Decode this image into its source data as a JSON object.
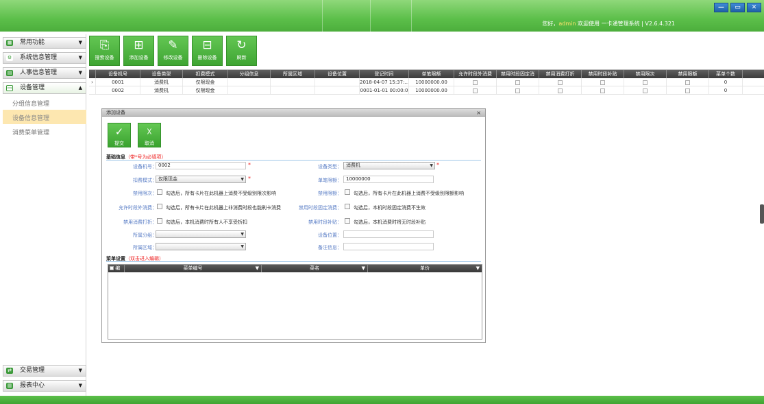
{
  "header": {
    "greeting": "您好，",
    "user": "admin",
    "welcome": "欢迎使用 一卡通管理系统  |  V2.6.4.321",
    "window_buttons": [
      "—",
      "▭",
      "✕"
    ]
  },
  "sidebar": {
    "sections": [
      {
        "label": "常用功能",
        "icon": "grid-icon"
      },
      {
        "label": "系统信息管理",
        "icon": "gear-icon"
      },
      {
        "label": "人事信息管理",
        "icon": "id-card-icon"
      },
      {
        "label": "设备管理",
        "icon": "device-icon"
      }
    ],
    "subitems": [
      "分组信息管理",
      "设备信息管理",
      "消费菜单管理"
    ],
    "selected_subitem": "设备信息管理",
    "bottom_sections": [
      {
        "label": "交易管理",
        "icon": "exchange-icon"
      },
      {
        "label": "报表中心",
        "icon": "chart-icon"
      }
    ]
  },
  "toolbar": {
    "buttons": [
      "搜索设备",
      "添加设备",
      "修改设备",
      "删除设备",
      "刷新"
    ]
  },
  "grid": {
    "headers": [
      "设备机号",
      "设备类型",
      "扣费模式",
      "分组信息",
      "所属区域",
      "设备位置",
      "登记时间",
      "单笔限额",
      "允许时段外消费",
      "禁用时段固定消",
      "禁用消费打折",
      "禁用时段补贴",
      "禁用限次",
      "禁用限额",
      "菜单个数"
    ],
    "rows": [
      [
        "0001",
        "消费机",
        "仅限现金",
        "",
        "",
        "",
        "2018-04-07 15:37:…",
        "10000000.00",
        "",
        "",
        "",
        "",
        "",
        "",
        "0"
      ],
      [
        "0002",
        "消费机",
        "仅限现金",
        "",
        "",
        "",
        "0001-01-01 00:00:0",
        "10000000.00",
        "",
        "",
        "",
        "",
        "",
        "",
        "0"
      ]
    ]
  },
  "dialog": {
    "title": "添加设备",
    "close": "×",
    "submit_label": "提交",
    "cancel_label": "取消",
    "basic_section": "基础信息",
    "basic_hint": "（带*号为必填项）",
    "fields": {
      "device_no_label": "设备机号：",
      "device_no_value": "0002",
      "device_type_label": "设备类型：",
      "device_type_value": "消费机",
      "mode_label": "扣费模式：",
      "mode_value": "仅限现金",
      "limit_label": "单笔限额：",
      "limit_value": "10000000",
      "disable_count_label": "禁用限次：",
      "disable_count_text": "勾选后，所有卡片在此机器上消费不受级别限次影响",
      "disable_amount_label": "禁用限额：",
      "disable_amount_text": "勾选后，所有卡片在此机器上消费不受级别限额影响",
      "allow_out_label": "允许时段外消费：",
      "allow_out_text": "勾选后，所有卡片在此机器上非消费时段也能刷卡消费",
      "disable_fixed_label": "禁用时段固定消费：",
      "disable_fixed_text": "勾选后，本机时段固定消费不生效",
      "disable_discount_label": "禁用消费打折：",
      "disable_discount_text": "勾选后，本机消费时所有人不享受折扣",
      "disable_subsidy_label": "禁用时段补贴：",
      "disable_subsidy_text": "勾选后，本机消费时将无时段补贴",
      "group_label": "所属分组：",
      "location_label": "设备位置：",
      "area_label": "所属区域：",
      "remark_label": "备注信息："
    },
    "menu_section": "菜单设置",
    "menu_hint": "（双击进入编辑）",
    "menu_headers": [
      "编号",
      "菜单编号",
      "菜名",
      "单价"
    ]
  }
}
